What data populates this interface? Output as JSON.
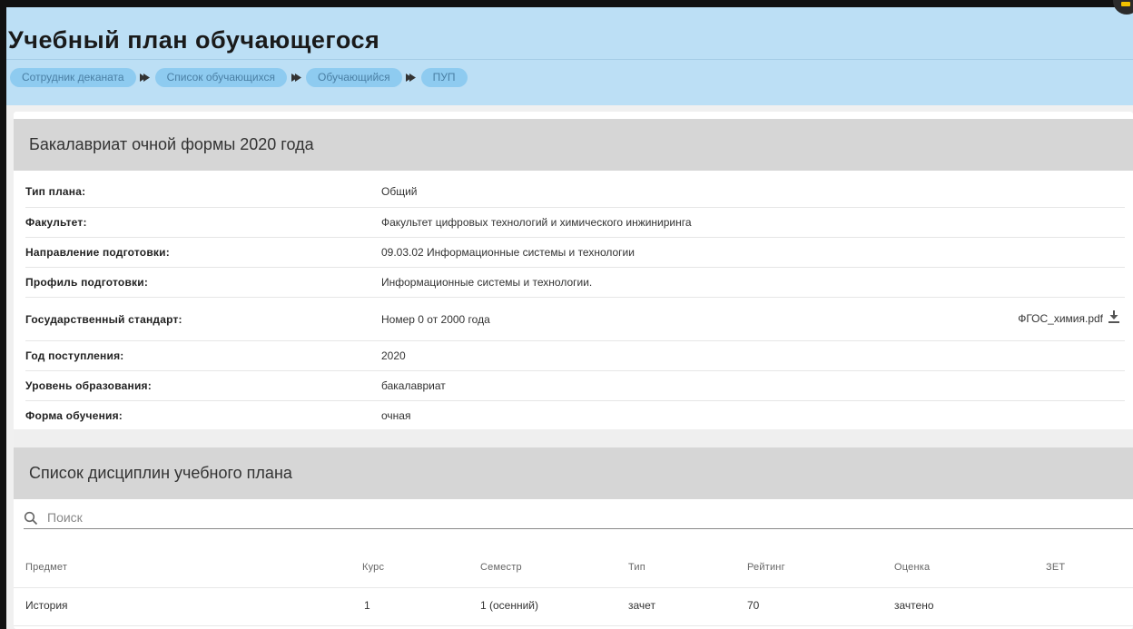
{
  "title": "Учебный план обучающегося",
  "breadcrumbs": [
    "Сотрудник деканата",
    "Список обучающихся",
    "Обучающийся",
    "ПУП"
  ],
  "plan": {
    "heading": "Бакалавриат очной формы 2020 года",
    "rows": [
      {
        "label": "Тип плана:",
        "value": "Общий"
      },
      {
        "label": "Факультет:",
        "value": "Факультет цифровых технологий и химического инжиниринга"
      },
      {
        "label": "Направление подготовки:",
        "value": "09.03.02 Информационные системы и технологии"
      },
      {
        "label": "Профиль подготовки:",
        "value": "Информационные системы и технологии."
      },
      {
        "label": "Государственный стандарт:",
        "value": "Номер 0 от 2000 года",
        "file": "ФГОС_химия.pdf"
      },
      {
        "label": "Год поступления:",
        "value": "2020"
      },
      {
        "label": "Уровень образования:",
        "value": "бакалавриат"
      },
      {
        "label": "Форма обучения:",
        "value": "очная"
      }
    ]
  },
  "disciplines": {
    "heading": "Список дисциплин учебного плана",
    "search_placeholder": "Поиск",
    "columns": [
      "Предмет",
      "Курс",
      "Семестр",
      "Тип",
      "Рейтинг",
      "Оценка",
      "ЗЕТ"
    ],
    "rows": [
      [
        "История",
        "1",
        "1 (осенний)",
        "зачет",
        "70",
        "зачтено",
        ""
      ]
    ]
  },
  "icons": {
    "search": "search-icon",
    "download": "download-icon",
    "breadcrumb_separator": "chevron-right-icon"
  },
  "colors": {
    "header_bg": "#bcdff5",
    "breadcrumb_bg": "#8ecbf0",
    "section_bg": "#d6d6d6"
  }
}
